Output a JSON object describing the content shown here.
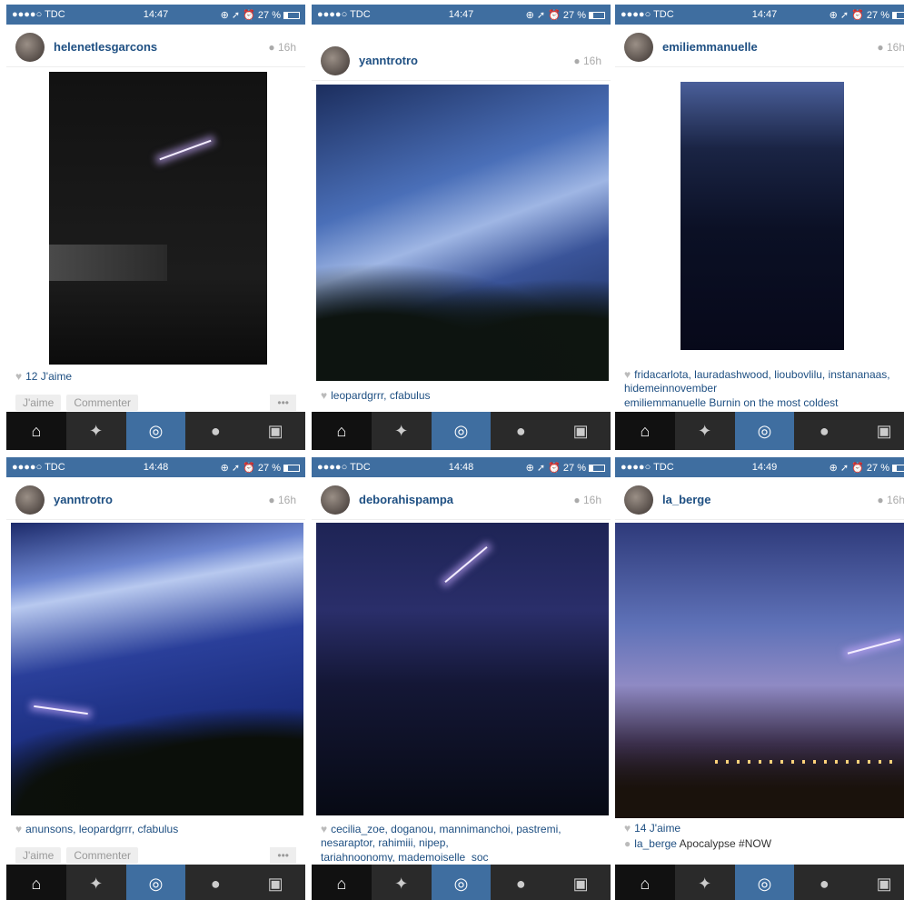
{
  "status": {
    "carrier": "●●●●○ TDC",
    "battery": "27 %"
  },
  "panels": [
    {
      "time": "14:47",
      "user": "helenetlesgarcons",
      "age": "16h",
      "likes": "12 J'aime",
      "actions": [
        "J'aime",
        "Commenter",
        "•••"
      ]
    },
    {
      "time": "14:47",
      "user": "yanntrotro",
      "age": "16h",
      "likes": "leopardgrrr, cfabulus"
    },
    {
      "time": "14:47",
      "user": "emiliemmanuelle",
      "age": "16h",
      "likes": "fridacarlota, lauradashwood, lioubovlilu, instananaas, hidemeinnovember",
      "caption": "emiliemmanuelle Burnin on the most coldest"
    },
    {
      "time": "14:48",
      "user": "yanntrotro",
      "age": "16h",
      "likes": "anunsons, leopardgrrr, cfabulus",
      "actions": [
        "J'aime",
        "Commenter",
        "•••"
      ]
    },
    {
      "time": "14:48",
      "user": "deborahispampa",
      "age": "16h",
      "likes": "cecilia_zoe, doganou, mannimanchoi, pastremi, nesaraptor, rahimiii, nipep,",
      "caption": "tariahnoonomy, mademoiselle_soc"
    },
    {
      "time": "14:49",
      "user": "la_berge",
      "age": "16h",
      "likes": "14 J'aime",
      "caption_user": "la_berge",
      "caption": "Apocalypse #NOW"
    }
  ],
  "tabs": [
    "home-icon",
    "explore-icon",
    "camera-icon",
    "activity-icon",
    "profile-icon"
  ]
}
